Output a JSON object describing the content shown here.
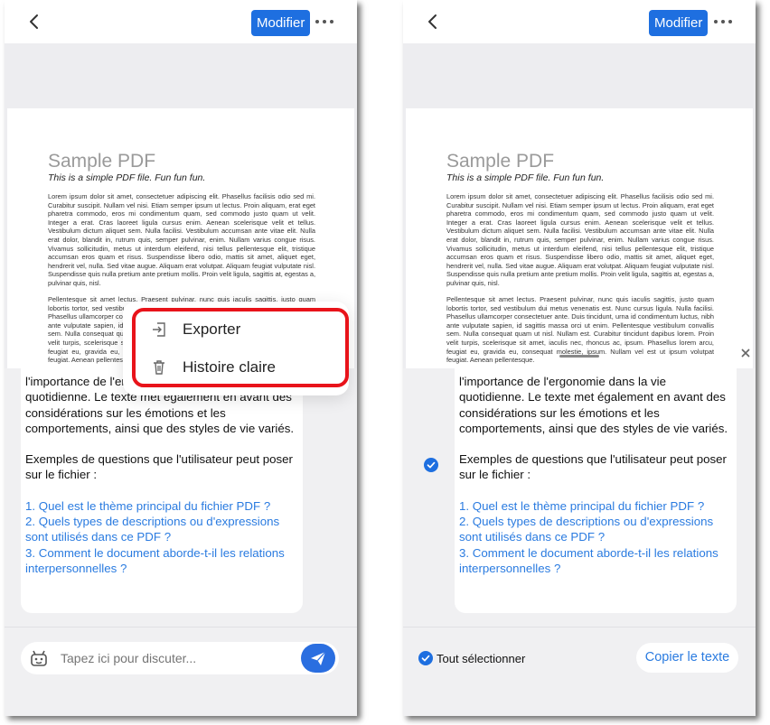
{
  "header": {
    "edit_label": "Modifier"
  },
  "pdf": {
    "title": "Sample PDF",
    "subtitle": "This is a simple PDF file. Fun fun fun.",
    "paragraph1": "Lorem ipsum dolor sit amet, consectetuer adipiscing elit. Phasellus facilisis odio sed mi. Curabitur suscipit. Nullam vel nisi. Etiam semper ipsum ut lectus. Proin aliquam, erat eget pharetra commodo, eros mi condimentum quam, sed commodo justo quam ut velit. Integer a erat. Cras laoreet ligula cursus enim. Aenean scelerisque velit et tellus. Vestibulum dictum aliquet sem. Nulla facilisi. Vestibulum accumsan ante vitae elit. Nulla erat dolor, blandit in, rutrum quis, semper pulvinar, enim. Nullam varius congue risus. Vivamus sollicitudin, metus ut interdum eleifend, nisi tellus pellentesque elit, tristique accumsan eros quam et risus. Suspendisse libero odio, mattis sit amet, aliquet eget, hendrerit vel, nulla. Sed vitae augue. Aliquam erat volutpat. Aliquam feugiat vulputate nisl. Suspendisse quis nulla pretium ante pretium mollis. Proin velit ligula, sagittis at, egestas a, pulvinar quis, nisl.",
    "paragraph2": "Pellentesque sit amet lectus. Praesent pulvinar, nunc quis iaculis sagittis, justo quam lobortis tortor, sed vestibulum dui metus venenatis est. Nunc cursus ligula. Nulla facilisi. Phasellus ullamcorper consectetuer ante. Duis tincidunt, urna id condimentum luctus, nibh ante vulputate sapien, id sagittis massa orci ut enim. Pellentesque vestibulum convallis sem. Nulla consequat quam ut nisl. Nullam est. Curabitur tincidunt dapibus lorem. Proin velit turpis, scelerisque sit amet, iaculis nec, rhoncus ac, ipsum. Phasellus lorem arcu, feugiat eu, gravida eu, consequat molestie, ipsum. Nullam vel est ut ipsum volutpat feugiat. Aenean pellentesque."
  },
  "message": {
    "line_head": "l'importance de l'ergonomie dans la vie",
    "para1": "quotidienne. Le texte met également en avant des considérations sur les émotions et les comportements, ainsi que des styles de vie variés.",
    "para2": "Exemples de questions que l'utilisateur peut poser sur le fichier :",
    "q1": "1. Quel est le thème principal du fichier PDF ?",
    "q2": "2. Quels types de descriptions ou d'expressions sont utilisés dans ce PDF ?",
    "q3": "3. Comment le document aborde-t-il les relations interpersonnelles ?"
  },
  "input": {
    "placeholder": "Tapez ici pour discuter..."
  },
  "menu": {
    "export_label": "Exporter",
    "clear_label": "Histoire claire"
  },
  "selection": {
    "select_all_label": "Tout sélectionner",
    "copy_label": "Copier le texte"
  },
  "colors": {
    "accent": "#1e6fe0",
    "link": "#2a7be0",
    "highlight": "#e8131a"
  }
}
